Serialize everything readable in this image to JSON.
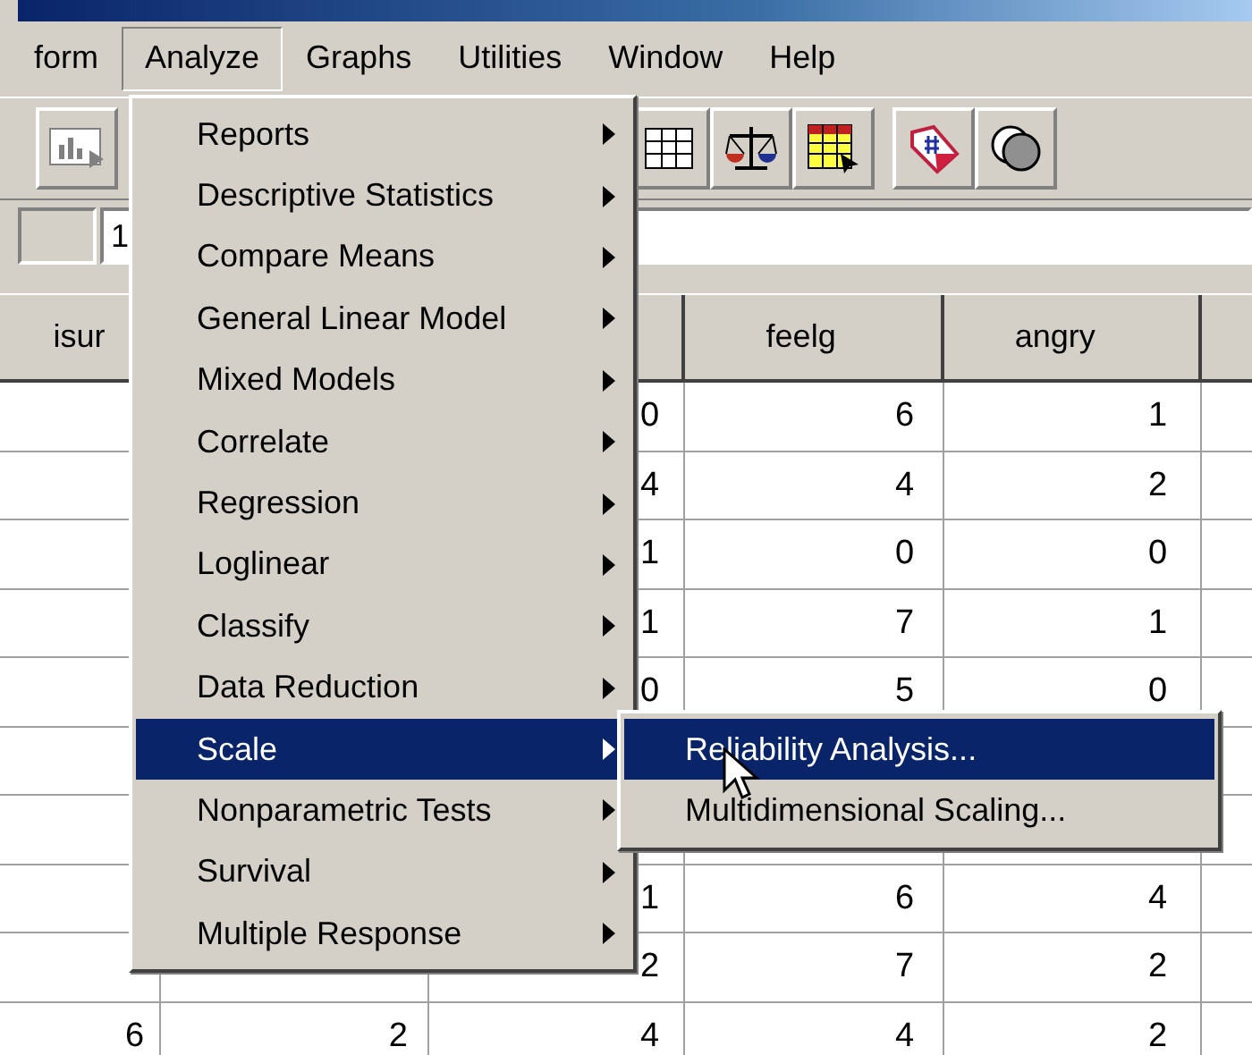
{
  "menu_bar": [
    {
      "label": "form",
      "selected": false
    },
    {
      "label": "Analyze",
      "selected": true
    },
    {
      "label": "Graphs",
      "selected": false
    },
    {
      "label": "Utilities",
      "selected": false
    },
    {
      "label": "Window",
      "selected": false
    },
    {
      "label": "Help",
      "selected": false
    }
  ],
  "cell_editor": {
    "value": "1"
  },
  "grid": {
    "columns": [
      {
        "label": "isur"
      },
      {},
      {},
      {
        "label": "feelg"
      },
      {
        "label": "angry"
      },
      {}
    ],
    "rows": [
      [
        null,
        null,
        "0",
        "6",
        "1",
        null
      ],
      [
        null,
        null,
        "4",
        "4",
        "2",
        null
      ],
      [
        null,
        null,
        "1",
        "0",
        "0",
        null
      ],
      [
        null,
        null,
        "1",
        "7",
        "1",
        null
      ],
      [
        null,
        null,
        "0",
        "5",
        "0",
        null
      ],
      [
        null,
        null,
        null,
        null,
        null,
        null
      ],
      [
        null,
        null,
        null,
        null,
        null,
        null
      ],
      [
        null,
        null,
        "1",
        "6",
        "4",
        null
      ],
      [
        null,
        null,
        "2",
        "7",
        "2",
        null
      ],
      [
        "6",
        "2",
        "4",
        "4",
        "2",
        null
      ]
    ]
  },
  "analyze_menu": [
    {
      "label": "Reports",
      "submenu": true,
      "selected": false
    },
    {
      "label": "Descriptive Statistics",
      "submenu": true,
      "selected": false
    },
    {
      "label": "Compare Means",
      "submenu": true,
      "selected": false
    },
    {
      "label": "General Linear Model",
      "submenu": true,
      "selected": false
    },
    {
      "label": "Mixed Models",
      "submenu": true,
      "selected": false
    },
    {
      "label": "Correlate",
      "submenu": true,
      "selected": false
    },
    {
      "label": "Regression",
      "submenu": true,
      "selected": false
    },
    {
      "label": "Loglinear",
      "submenu": true,
      "selected": false
    },
    {
      "label": "Classify",
      "submenu": true,
      "selected": false
    },
    {
      "label": "Data Reduction",
      "submenu": true,
      "selected": false
    },
    {
      "label": "Scale",
      "submenu": true,
      "selected": true
    },
    {
      "label": "Nonparametric Tests",
      "submenu": true,
      "selected": false
    },
    {
      "label": "Survival",
      "submenu": true,
      "selected": false
    },
    {
      "label": "Multiple Response",
      "submenu": true,
      "selected": false
    }
  ],
  "scale_submenu": [
    {
      "label": "Reliability Analysis...",
      "submenu": false,
      "selected": true
    },
    {
      "label": "Multidimensional Scaling...",
      "submenu": false,
      "selected": false
    }
  ]
}
